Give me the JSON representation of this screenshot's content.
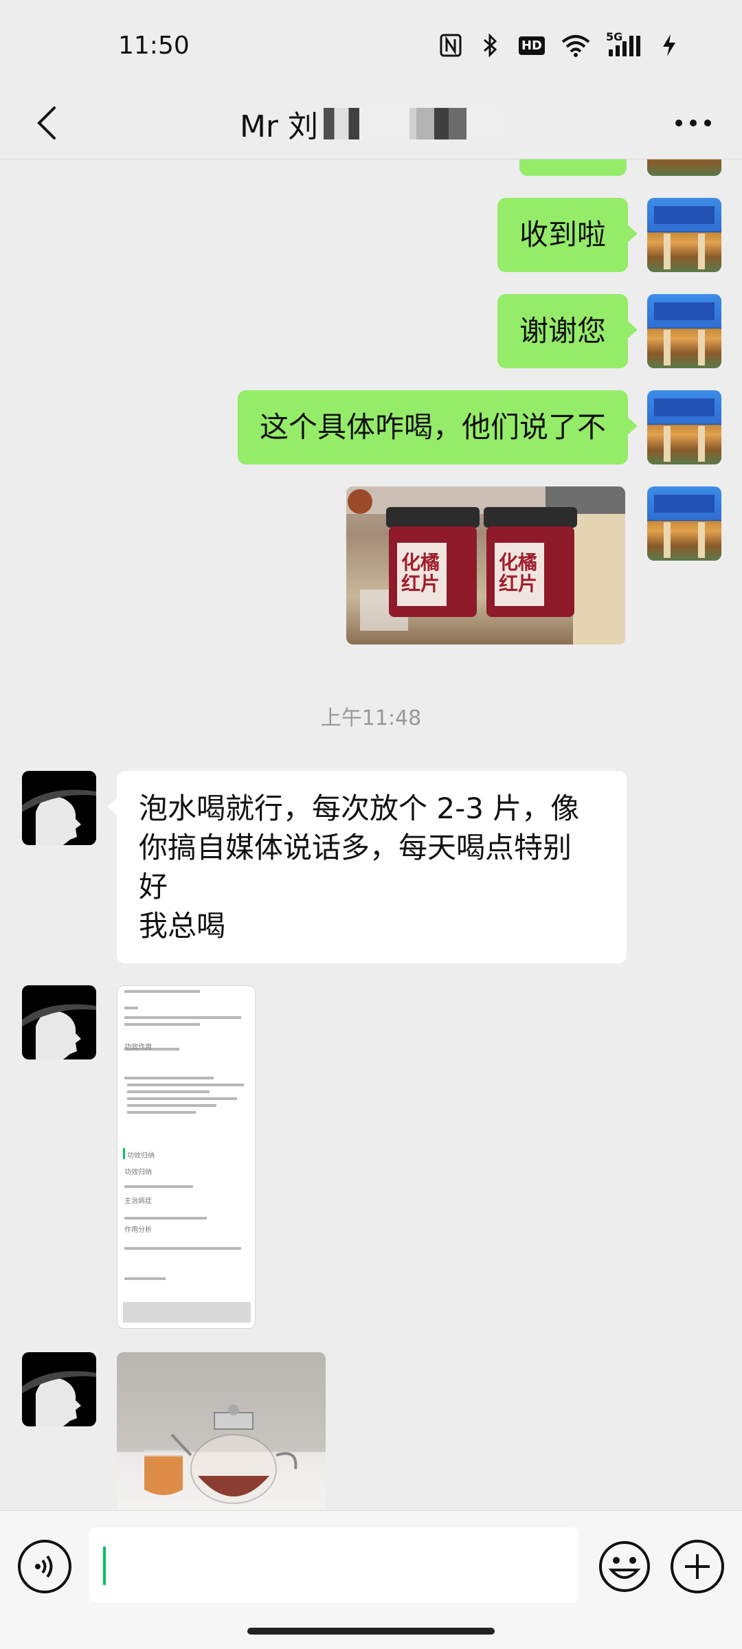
{
  "status_bar": {
    "time": "11:50",
    "icons": [
      "nfc-icon",
      "bluetooth-icon",
      "hd-icon",
      "wifi-icon",
      "5g-signal-icon",
      "charging-icon"
    ],
    "hd_label": "HD",
    "net_label": "5G"
  },
  "header": {
    "title": "Mr 刘",
    "back_icon": "chevron-left-icon",
    "more_icon": "more-icon"
  },
  "messages": {
    "out_1": "收到啦",
    "out_2": "谢谢您",
    "out_3": "这个具体咋喝，他们说了不",
    "timestamp": "上午11:48",
    "in_1_lines": [
      "泡水喝就行，每次放个 2-3 片，像",
      "你搞自媒体说话多，每天喝点特别",
      "好",
      "我总喝"
    ]
  },
  "product_image": {
    "label_line1": "化橘",
    "label_line2": "红片"
  },
  "document_image": {
    "headings": [
      "功效作用",
      "功效归纳",
      "主治病症",
      "作用分析"
    ]
  },
  "input_bar": {
    "placeholder": "",
    "voice_icon": "voice-icon",
    "emoji_icon": "emoji-icon",
    "plus_icon": "plus-icon"
  },
  "colors": {
    "background": "#ededed",
    "outgoing_bubble": "#95ec69",
    "incoming_bubble": "#ffffff",
    "accent": "#07c160"
  }
}
